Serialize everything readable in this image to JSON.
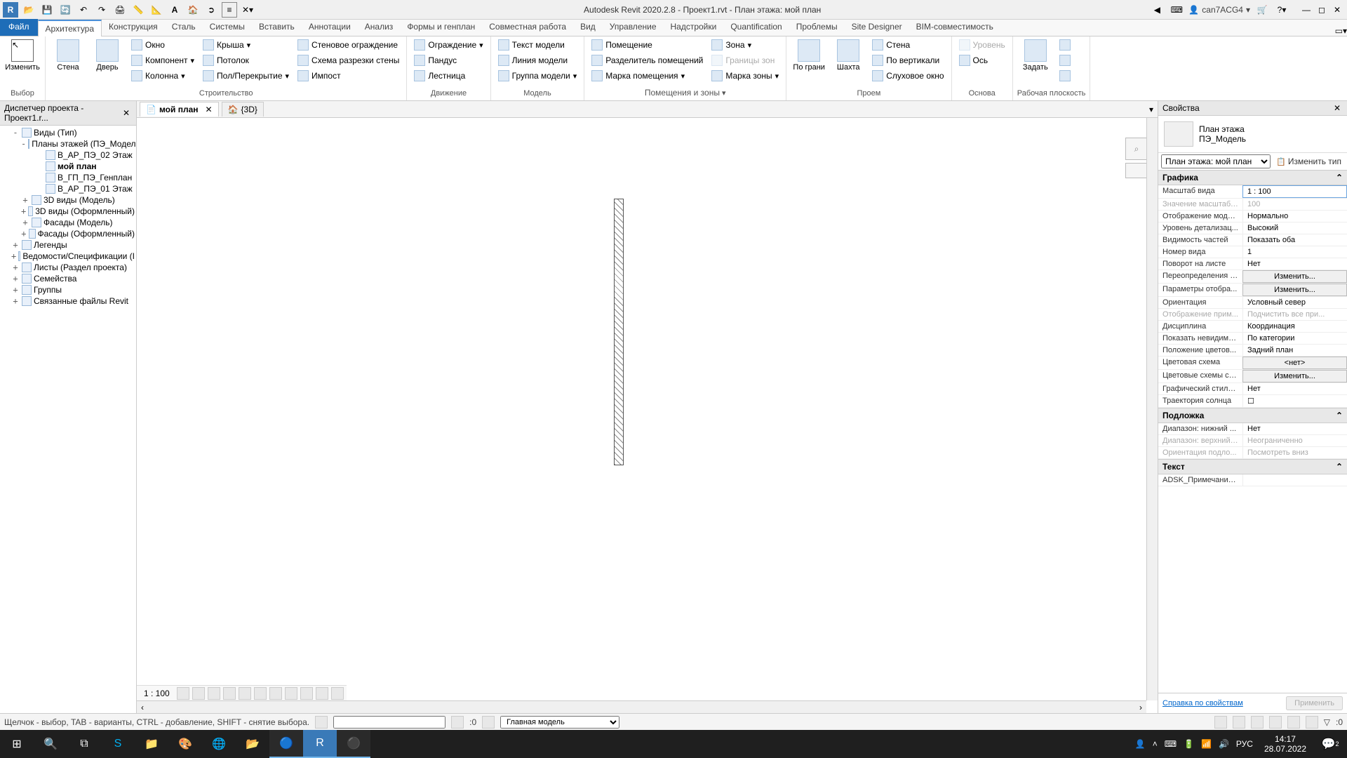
{
  "app": {
    "title": "Autodesk Revit 2020.2.8 - Проект1.rvt - План этажа: мой план",
    "user": "can7ACG4"
  },
  "ribbon": {
    "file": "Файл",
    "tabs": [
      "Архитектура",
      "Конструкция",
      "Сталь",
      "Системы",
      "Вставить",
      "Аннотации",
      "Анализ",
      "Формы и генплан",
      "Совместная работа",
      "Вид",
      "Управление",
      "Надстройки",
      "Quantification",
      "Проблемы",
      "Site Designer",
      "BIM-совместимость"
    ],
    "active": 0,
    "panels": {
      "select": {
        "modify": "Изменить",
        "label": "Выбор"
      },
      "build": {
        "wall": "Стена",
        "door": "Дверь",
        "window": "Окно",
        "component": "Компонент",
        "column": "Колонна",
        "roof": "Крыша",
        "ceiling": "Потолок",
        "floor": "Пол/Перекрытие",
        "curtain_wall": "Стеновое ограждение",
        "curtain_grid": "Схема разрезки стены",
        "mullion": "Импост",
        "label": "Строительство"
      },
      "circulation": {
        "railing": "Ограждение",
        "ramp": "Пандус",
        "stair": "Лестница",
        "label": "Движение"
      },
      "model": {
        "model_text": "Текст модели",
        "model_line": "Линия  модели",
        "model_group": "Группа модели",
        "label": "Модель"
      },
      "room": {
        "room": "Помещение",
        "room_sep": "Разделитель помещений",
        "room_tag": "Марка помещения",
        "area": "Зона",
        "area_bound": "Границы зон",
        "area_tag": "Марка  зоны",
        "label": "Помещения и зоны"
      },
      "opening": {
        "by_face": "По грани",
        "shaft": "Шахта",
        "wall": "Стена",
        "vertical": "По вертикали",
        "dormer": "Слуховое окно",
        "label": "Проем"
      },
      "datum": {
        "level": "Уровень",
        "grid": "Ось",
        "label": "Основа"
      },
      "workplane": {
        "set": "Задать",
        "label": "Рабочая плоскость"
      }
    }
  },
  "project_browser": {
    "title": "Диспетчер проекта - Проект1.r...",
    "items": [
      {
        "t": "Виды (Тип)",
        "l": 0,
        "e": "-"
      },
      {
        "t": "Планы этажей (ПЭ_Модель",
        "l": 1,
        "e": "-"
      },
      {
        "t": "В_АР_ПЭ_02 Этаж",
        "l": 2
      },
      {
        "t": "мой план",
        "l": 2,
        "b": true
      },
      {
        "t": "В_ГП_ПЭ_Генплан",
        "l": 2
      },
      {
        "t": "В_АР_ПЭ_01 Этаж",
        "l": 2
      },
      {
        "t": "3D виды (Модель)",
        "l": 1,
        "e": "+"
      },
      {
        "t": "3D виды (Оформленный)",
        "l": 1,
        "e": "+"
      },
      {
        "t": "Фасады (Модель)",
        "l": 1,
        "e": "+"
      },
      {
        "t": "Фасады (Оформленный)",
        "l": 1,
        "e": "+"
      },
      {
        "t": "Легенды",
        "l": 0,
        "e": "+"
      },
      {
        "t": "Ведомости/Спецификации (I",
        "l": 0,
        "e": "+"
      },
      {
        "t": "Листы (Раздел проекта)",
        "l": 0,
        "e": "+"
      },
      {
        "t": "Семейства",
        "l": 0,
        "e": "+"
      },
      {
        "t": "Группы",
        "l": 0,
        "e": "+"
      },
      {
        "t": "Связанные файлы Revit",
        "l": 0,
        "e": "+"
      }
    ]
  },
  "view_tabs": {
    "tab1": "мой план",
    "tab2": "{3D}"
  },
  "view_controls": {
    "scale": "1 : 100"
  },
  "properties": {
    "title": "Свойства",
    "type_name": "План этажа",
    "type_sub": "ПЭ_Модель",
    "selector": "План этажа: мой план",
    "edit_type": "Изменить тип",
    "groups": {
      "graphics": "Графика",
      "underlay": "Подложка",
      "text": "Текст"
    },
    "rows": [
      {
        "n": "Масштаб вида",
        "v": "1 : 100",
        "hl": true
      },
      {
        "n": "Значение масштаба...",
        "v": "100",
        "d": true
      },
      {
        "n": "Отображение моде...",
        "v": "Нормально"
      },
      {
        "n": "Уровень детализац...",
        "v": "Высокий"
      },
      {
        "n": "Видимость частей",
        "v": "Показать оба"
      },
      {
        "n": "Номер вида",
        "v": "1"
      },
      {
        "n": "Поворот на листе",
        "v": "Нет"
      },
      {
        "n": "Переопределения в...",
        "v": "Изменить...",
        "btn": true
      },
      {
        "n": "Параметры отобра...",
        "v": "Изменить...",
        "btn": true
      },
      {
        "n": "Ориентация",
        "v": "Условный север"
      },
      {
        "n": "Отображение прим...",
        "v": "Подчистить все при...",
        "d": true
      },
      {
        "n": "Дисциплина",
        "v": "Координация"
      },
      {
        "n": "Показать невидимы...",
        "v": "По категории"
      },
      {
        "n": "Положение цветов...",
        "v": "Задний план"
      },
      {
        "n": "Цветовая схема",
        "v": "<нет>",
        "btn": true
      },
      {
        "n": "Цветовые схемы си...",
        "v": "Изменить...",
        "btn": true
      },
      {
        "n": "Графический стиль ...",
        "v": "Нет"
      },
      {
        "n": "Траектория солнца",
        "v": "☐"
      }
    ],
    "underlay_rows": [
      {
        "n": "Диапазон: нижний ...",
        "v": "Нет"
      },
      {
        "n": "Диапазон: верхний ...",
        "v": "Неограниченно",
        "d": true
      },
      {
        "n": "Ориентация подло...",
        "v": "Посмотреть вниз",
        "d": true
      }
    ],
    "text_rows": [
      {
        "n": "ADSK_Примечание ...",
        "v": ""
      }
    ],
    "help_link": "Справка по свойствам",
    "apply": "Применить"
  },
  "statusbar": {
    "hint": "Щелчок - выбор, TAB - варианты, CTRL - добавление, SHIFT - снятие выбора.",
    "zero": ":0",
    "main_model": "Главная модель",
    "filter_zero": ":0"
  },
  "taskbar": {
    "time": "14:17",
    "date": "28.07.2022",
    "lang": "РУС",
    "notif": "2"
  }
}
